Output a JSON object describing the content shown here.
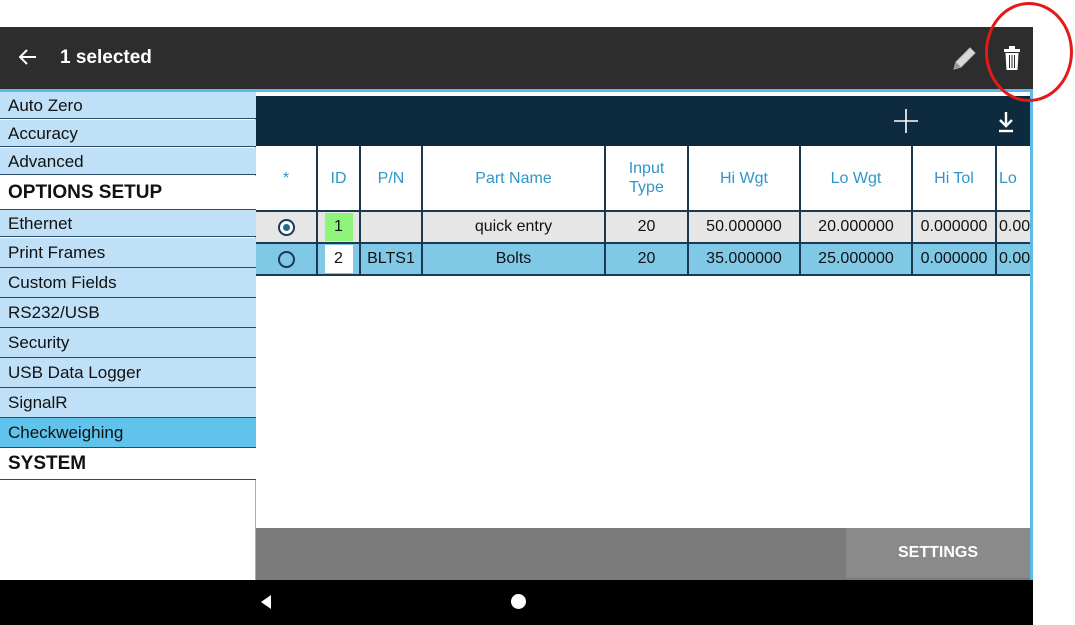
{
  "appbar": {
    "title": "1 selected",
    "back_icon": "arrow-left-icon",
    "edit_icon": "pencil-icon",
    "delete_icon": "trash-icon"
  },
  "sidebar": {
    "items": [
      {
        "label": "Auto Zero",
        "type": "item"
      },
      {
        "label": "Accuracy",
        "type": "item"
      },
      {
        "label": "Advanced",
        "type": "item"
      },
      {
        "label": "OPTIONS SETUP",
        "type": "header"
      },
      {
        "label": "Ethernet",
        "type": "item"
      },
      {
        "label": "Print Frames",
        "type": "item"
      },
      {
        "label": "Custom Fields",
        "type": "item"
      },
      {
        "label": "RS232/USB",
        "type": "item"
      },
      {
        "label": "Security",
        "type": "item"
      },
      {
        "label": "USB Data Logger",
        "type": "item"
      },
      {
        "label": "SignalR",
        "type": "item"
      },
      {
        "label": "Checkweighing",
        "type": "active"
      },
      {
        "label": "SYSTEM",
        "type": "header"
      }
    ]
  },
  "toolbar": {
    "add_icon": "plus-icon",
    "download_icon": "download-icon"
  },
  "table": {
    "headers": [
      "*",
      "ID",
      "P/N",
      "Part Name",
      "Input Type",
      "Hi Wgt",
      "Lo Wgt",
      "Hi Tol",
      "Lo"
    ],
    "rows": [
      {
        "selected": true,
        "id": "1",
        "pn": "",
        "name": "quick entry",
        "input_type": "20",
        "hi_wgt": "50.000000",
        "lo_wgt": "20.000000",
        "hi_tol": "0.000000",
        "lo_tol": "0.00"
      },
      {
        "selected": false,
        "id": "2",
        "pn": "BLTS1",
        "name": "Bolts",
        "input_type": "20",
        "hi_wgt": "35.000000",
        "lo_wgt": "25.000000",
        "hi_tol": "0.000000",
        "lo_tol": "0.00"
      }
    ]
  },
  "footer": {
    "settings_label": "SETTINGS"
  },
  "colors": {
    "appbar": "#2d2d2d",
    "sidebar_item": "#bfe0f6",
    "sidebar_active": "#5fc3ec",
    "toolbar": "#0d2a3e",
    "row_selected": "#7fc8e6",
    "id_highlight": "#8ef57a",
    "header_text": "#2f96c8",
    "annotation": "#e21a1a"
  }
}
